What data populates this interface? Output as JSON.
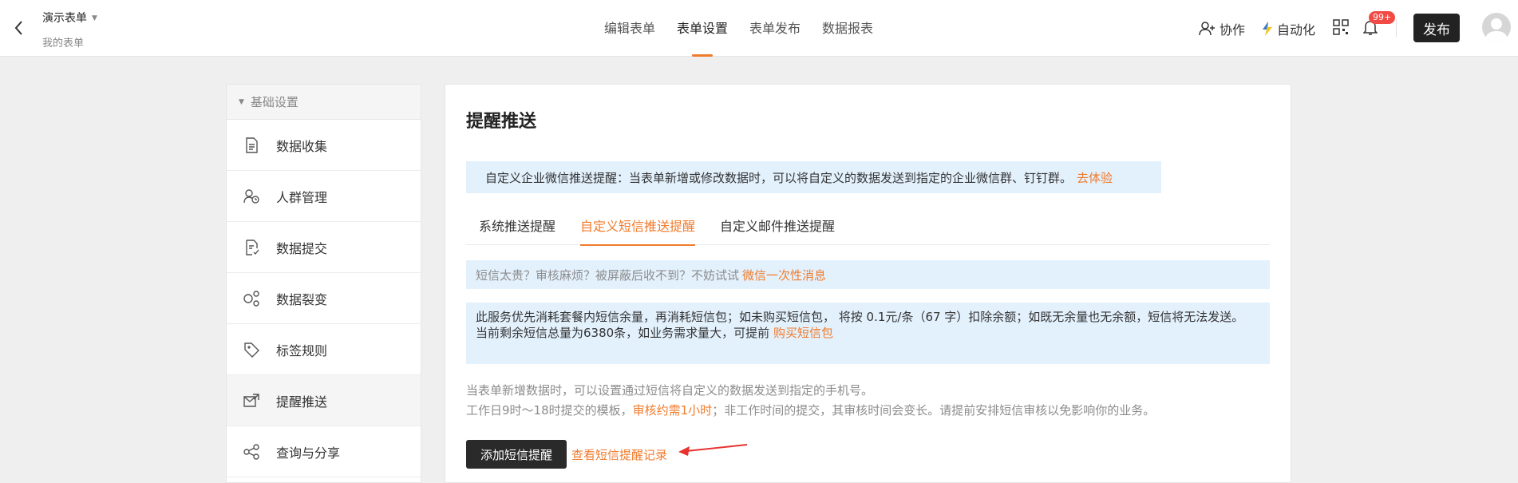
{
  "header": {
    "form_title": "演示表单",
    "form_subtitle": "我的表单",
    "tabs": [
      {
        "label": "编辑表单",
        "active": false
      },
      {
        "label": "表单设置",
        "active": true
      },
      {
        "label": "表单发布",
        "active": false
      },
      {
        "label": "数据报表",
        "active": false
      }
    ],
    "collaborate_label": "协作",
    "automation_label": "自动化",
    "notification_count": "99+",
    "publish_label": "发布"
  },
  "sidebar": {
    "section_label": "基础设置",
    "items": [
      {
        "label": "数据收集",
        "icon": "document-icon",
        "active": false
      },
      {
        "label": "人群管理",
        "icon": "user-group-icon",
        "active": false
      },
      {
        "label": "数据提交",
        "icon": "submit-icon",
        "active": false
      },
      {
        "label": "数据裂变",
        "icon": "fission-icon",
        "active": false
      },
      {
        "label": "标签规则",
        "icon": "tag-icon",
        "active": false
      },
      {
        "label": "提醒推送",
        "icon": "push-icon",
        "active": true
      },
      {
        "label": "查询与分享",
        "icon": "share-icon",
        "active": false
      }
    ]
  },
  "main": {
    "title": "提醒推送",
    "banner_text": "自定义企业微信推送提醒：当表单新增或修改数据时，可以将自定义的数据发送到指定的企业微信群、钉钉群。",
    "banner_link": "去体验",
    "sub_tabs": [
      {
        "label": "系统推送提醒",
        "active": false
      },
      {
        "label": "自定义短信推送提醒",
        "active": true
      },
      {
        "label": "自定义邮件推送提醒",
        "active": false
      }
    ],
    "tip_text": "短信太贵？审核麻烦？被屏蔽后收不到？不妨试试",
    "tip_link": "微信一次性消息",
    "note_line1": "此服务优先消耗套餐内短信余量，再消耗短信包；如未购买短信包， 将按 0.1元/条（67 字）扣除余额；如既无余量也无余额，短信将无法发送。",
    "note_line2": "当前剩余短信总量为6380条，如业务需求量大，可提前",
    "note_link": "购买短信包",
    "desc_line1": "当表单新增数据时，可以设置通过短信将自定义的数据发送到指定的手机号。",
    "desc_line2_a": "工作日9时～18时提交的模板，",
    "desc_line2_highlight": "审核约需1小时",
    "desc_line2_b": "；非工作时间的提交，其审核时间会变长。请提前安排短信审核以免影响你的业务。",
    "add_button": "添加短信提醒",
    "record_link": "查看短信提醒记录"
  },
  "colors": {
    "accent": "#f07b2c",
    "banner_bg": "#e3f1fd",
    "dark_button": "#2a2a2a",
    "badge": "#f24a45",
    "arrow": "#e8322e"
  }
}
